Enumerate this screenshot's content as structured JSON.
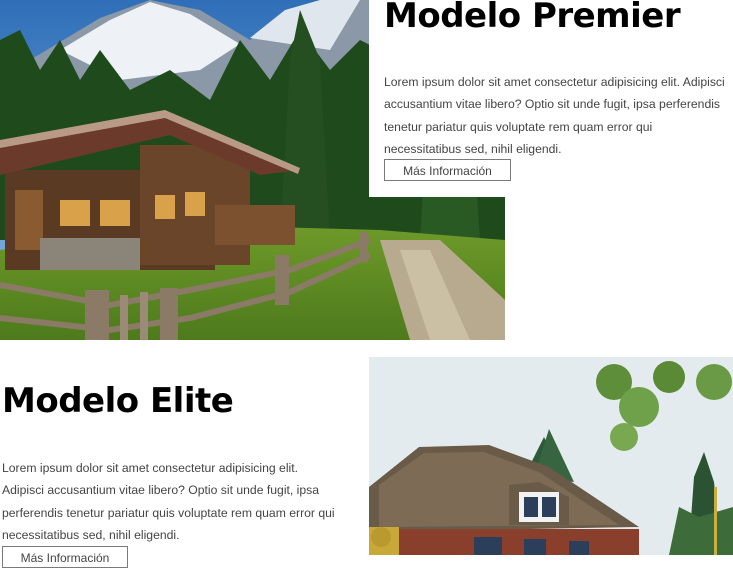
{
  "sections": [
    {
      "title": "Modelo Premier",
      "description": "Lorem ipsum dolor sit amet consectetur adipisicing elit. Adipisci accusantium vitae libero? Optio sit unde fugit, ipsa perferendis tenetur pariatur quis voluptate rem quam error qui necessitatibus sed, nihil eligendi.",
      "button_label": "Más Información"
    },
    {
      "title": "Modelo Elite",
      "description": "Lorem ipsum dolor sit amet consectetur adipisicing elit. Adipisci accusantium vitae libero? Optio sit unde fugit, ipsa perferendis tenetur pariatur quis voluptate rem quam error qui necessitatibus sed, nihil eligendi.",
      "button_label": "Más Información"
    }
  ]
}
